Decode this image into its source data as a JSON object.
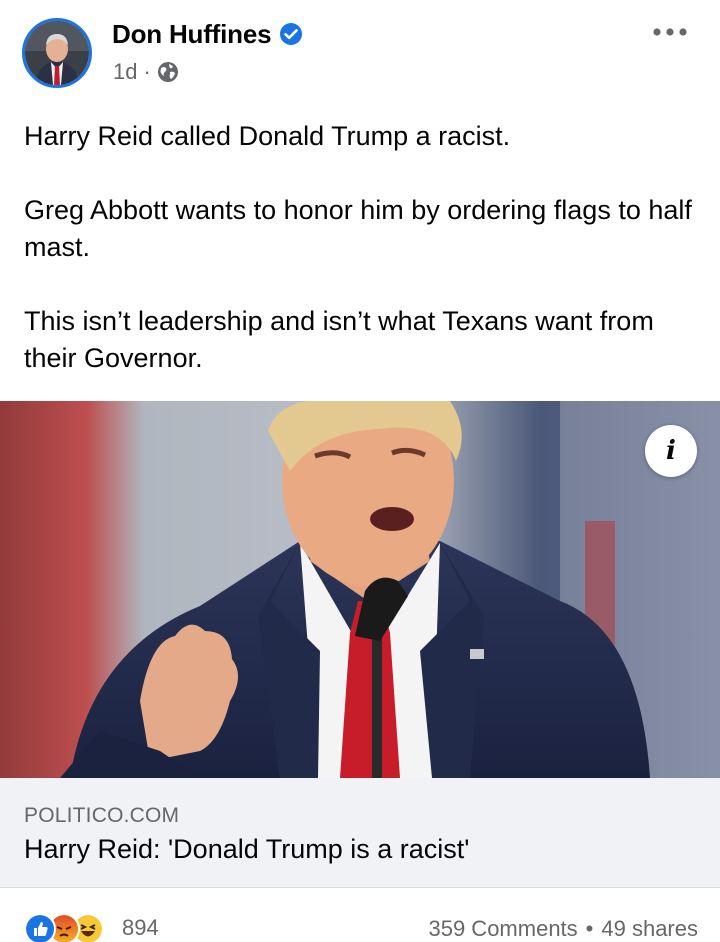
{
  "post": {
    "author": {
      "name": "Don Huffines",
      "verified": true
    },
    "meta": {
      "time": "1d",
      "separator": "·",
      "audience_icon": "globe-icon"
    },
    "more_icon": "more-options-icon",
    "text": [
      "Harry Reid called Donald Trump a racist.",
      "Greg Abbott wants to honor him by ordering flags to half mast.",
      "This isn’t leadership and isn’t what Texans want from their Governor."
    ],
    "link": {
      "domain": "POLITICO.COM",
      "title": "Harry Reid: 'Donald Trump is a racist'",
      "info_glyph": "i"
    },
    "reactions": {
      "icons": [
        "like-reaction-icon",
        "angry-reaction-icon",
        "haha-reaction-icon"
      ],
      "count": "894"
    },
    "engagement": {
      "comments": "359 Comments",
      "separator": "•",
      "shares": "49 shares"
    }
  },
  "colors": {
    "brand_blue": "#1b74e4",
    "secondary_text": "#65676b",
    "preview_bg": "#f0f2f5"
  }
}
